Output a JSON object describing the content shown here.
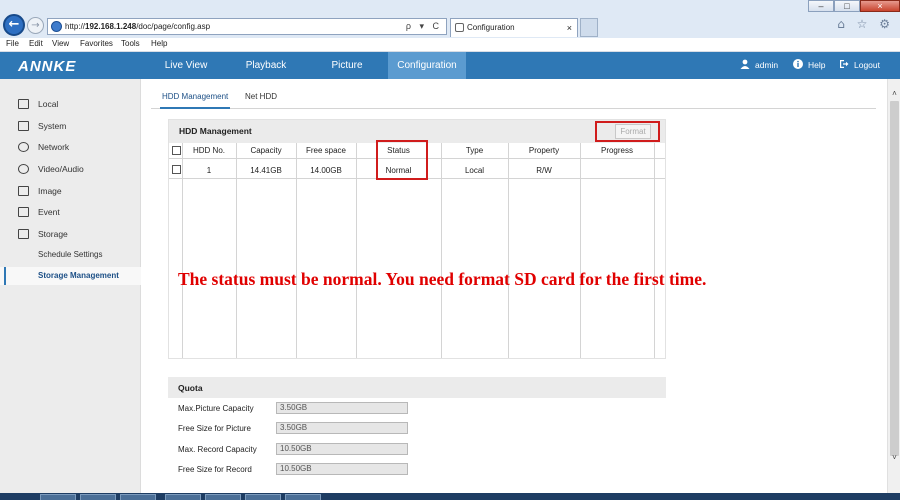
{
  "browser": {
    "address_prefix": "http://",
    "address_host": "192.168.1.248",
    "address_path": "/doc/page/config.asp",
    "address_icons": "ρ ▾ C",
    "tab_title": "Configuration",
    "tab_close": "×",
    "window_controls": [
      "–",
      "□",
      "×"
    ],
    "right_icons": "⌂ ☆ ⚙",
    "back": "←",
    "forward": "→"
  },
  "menu": [
    "File",
    "Edit",
    "View",
    "Favorites",
    "Tools",
    "Help"
  ],
  "header": {
    "logo": "ANNKE",
    "nav": [
      "Live View",
      "Playback",
      "Picture",
      "Configuration"
    ],
    "active_nav": "Configuration",
    "user": "admin",
    "help": "Help",
    "logout": "Logout"
  },
  "sidebar": {
    "items": [
      {
        "label": "Local",
        "icon": "monitor-icon"
      },
      {
        "label": "System",
        "icon": "system-icon"
      },
      {
        "label": "Network",
        "icon": "globe-icon"
      },
      {
        "label": "Video/Audio",
        "icon": "speaker-icon"
      },
      {
        "label": "Image",
        "icon": "image-icon"
      },
      {
        "label": "Event",
        "icon": "list-icon"
      },
      {
        "label": "Storage",
        "icon": "disk-icon"
      }
    ],
    "sub_items": [
      "Schedule Settings",
      "Storage Management"
    ],
    "active": "Storage Management"
  },
  "subtabs": [
    "HDD Management",
    "Net HDD"
  ],
  "hdd": {
    "title": "HDD Management",
    "format_label": "Format",
    "columns": [
      "HDD No.",
      "Capacity",
      "Free space",
      "Status",
      "Type",
      "Property",
      "Progress"
    ],
    "rows": [
      {
        "no": "1",
        "capacity": "14.41GB",
        "free": "14.00GB",
        "status": "Normal",
        "type": "Local",
        "property": "R/W",
        "progress": ""
      }
    ]
  },
  "annotation": "The status must be normal. You need format SD card for the first time.",
  "quota": {
    "title": "Quota",
    "fields": [
      {
        "label": "Max.Picture Capacity",
        "value": "3.50GB"
      },
      {
        "label": "Free Size for Picture",
        "value": "3.50GB"
      },
      {
        "label": "Max. Record Capacity",
        "value": "10.50GB"
      },
      {
        "label": "Free Size for Record",
        "value": "10.50GB"
      }
    ]
  },
  "colors": {
    "brand": "#2f78b5",
    "active_tab": "#5b9bd0",
    "highlight": "#d01c1c",
    "note": "#e00000"
  }
}
